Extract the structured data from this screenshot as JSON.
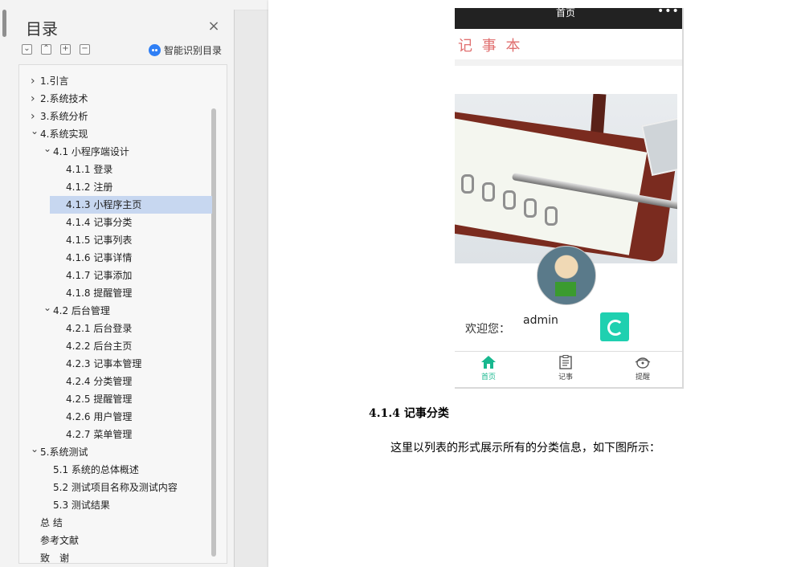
{
  "toc": {
    "title": "目录",
    "close_label": "×",
    "ai_label": "智能识别目录",
    "items": [
      {
        "label": "1.引言",
        "level": 0,
        "chevron": "right",
        "selected": false
      },
      {
        "label": "2.系统技术",
        "level": 0,
        "chevron": "right",
        "selected": false
      },
      {
        "label": "3.系统分析",
        "level": 0,
        "chevron": "right",
        "selected": false
      },
      {
        "label": "4.系统实现",
        "level": 0,
        "chevron": "down",
        "selected": false
      },
      {
        "label": "4.1 小程序端设计",
        "level": 1,
        "chevron": "down",
        "selected": false
      },
      {
        "label": "4.1.1 登录",
        "level": 2,
        "chevron": "",
        "selected": false
      },
      {
        "label": "4.1.2 注册",
        "level": 2,
        "chevron": "",
        "selected": false
      },
      {
        "label": "4.1.3 小程序主页",
        "level": 2,
        "chevron": "",
        "selected": true
      },
      {
        "label": "4.1.4 记事分类",
        "level": 2,
        "chevron": "",
        "selected": false
      },
      {
        "label": "4.1.5 记事列表",
        "level": 2,
        "chevron": "",
        "selected": false
      },
      {
        "label": "4.1.6 记事详情",
        "level": 2,
        "chevron": "",
        "selected": false
      },
      {
        "label": "4.1.7 记事添加",
        "level": 2,
        "chevron": "",
        "selected": false
      },
      {
        "label": "4.1.8 提醒管理",
        "level": 2,
        "chevron": "",
        "selected": false
      },
      {
        "label": "4.2 后台管理",
        "level": 1,
        "chevron": "down",
        "selected": false
      },
      {
        "label": "4.2.1 后台登录",
        "level": 2,
        "chevron": "",
        "selected": false
      },
      {
        "label": "4.2.2 后台主页",
        "level": 2,
        "chevron": "",
        "selected": false
      },
      {
        "label": "4.2.3 记事本管理",
        "level": 2,
        "chevron": "",
        "selected": false
      },
      {
        "label": "4.2.4 分类管理",
        "level": 2,
        "chevron": "",
        "selected": false
      },
      {
        "label": "4.2.5 提醒管理",
        "level": 2,
        "chevron": "",
        "selected": false
      },
      {
        "label": "4.2.6 用户管理",
        "level": 2,
        "chevron": "",
        "selected": false
      },
      {
        "label": "4.2.7 菜单管理",
        "level": 2,
        "chevron": "",
        "selected": false
      },
      {
        "label": "5.系统测试",
        "level": 0,
        "chevron": "down",
        "selected": false
      },
      {
        "label": "5.1 系统的总体概述",
        "level": 1,
        "chevron": "",
        "selected": false
      },
      {
        "label": "5.2 测试项目名称及测试内容",
        "level": 1,
        "chevron": "",
        "selected": false
      },
      {
        "label": "5.3 测试结果",
        "level": 1,
        "chevron": "",
        "selected": false
      },
      {
        "label": "总 结",
        "level": 0,
        "chevron": "",
        "selected": false
      },
      {
        "label": "参考文献",
        "level": 0,
        "chevron": "",
        "selected": false
      },
      {
        "label": "致　谢",
        "level": 0,
        "chevron": "",
        "selected": false
      }
    ]
  },
  "phone": {
    "bar_title": "首页",
    "bar_menu": "•••",
    "app_name": "记 事 本",
    "welcome_label": "欢迎您：",
    "username": "admin",
    "tabs": [
      {
        "label": "首页",
        "icon": "home-icon",
        "active": true
      },
      {
        "label": "记事",
        "icon": "notebook-icon",
        "active": false
      },
      {
        "label": "提醒",
        "icon": "reminder-icon",
        "active": false
      }
    ]
  },
  "document": {
    "heading": "4.1.4 记事分类",
    "body": "这里以列表的形式展示所有的分类信息，如下图所示："
  },
  "colors": {
    "accent": "#1fd0b0",
    "active_tab": "#18b88f",
    "toc_selected": "#c7d7f0"
  }
}
